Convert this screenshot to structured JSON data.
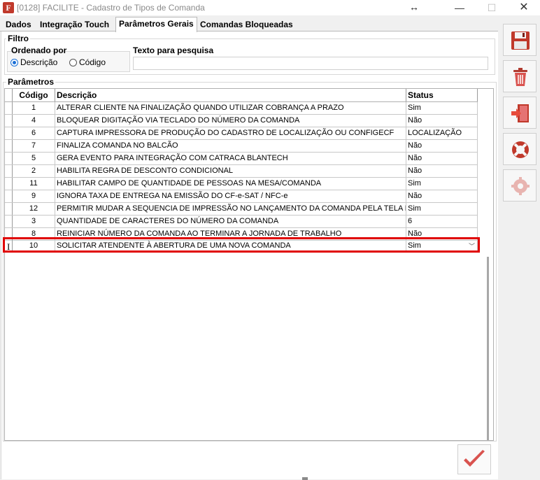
{
  "window": {
    "title": "[0128] FACILITE - Cadastro de Tipos de Comanda",
    "app_icon_letter": "F",
    "min_glyph": "—",
    "max_glyph": "☐",
    "close_glyph": "✕",
    "resize_glyph": "↔"
  },
  "tabs": [
    {
      "label": "Dados",
      "active": false
    },
    {
      "label": "Integração Touch",
      "active": false
    },
    {
      "label": "Parâmetros Gerais",
      "active": true
    },
    {
      "label": "Comandas Bloqueadas",
      "active": false
    }
  ],
  "filtro": {
    "group_label": "Filtro",
    "ordenado_label": "Ordenado por",
    "options": [
      {
        "label": "Descrição",
        "selected": true
      },
      {
        "label": "Código",
        "selected": false
      }
    ],
    "search_label": "Texto para pesquisa",
    "search_value": ""
  },
  "parametros": {
    "group_label": "Parâmetros",
    "columns": {
      "codigo": "Código",
      "descricao": "Descrição",
      "status": "Status"
    },
    "rows": [
      {
        "codigo": "1",
        "descricao": "ALTERAR CLIENTE NA FINALIZAÇÃO QUANDO UTILIZAR COBRANÇA A PRAZO",
        "status": "Sim"
      },
      {
        "codigo": "4",
        "descricao": "BLOQUEAR DIGITAÇÃO VIA TECLADO DO NÚMERO DA COMANDA",
        "status": "Não"
      },
      {
        "codigo": "6",
        "descricao": "CAPTURA IMPRESSORA DE PRODUÇÃO DO CADASTRO DE LOCALIZAÇÃO OU CONFIGECF",
        "status": "LOCALIZAÇÃO"
      },
      {
        "codigo": "7",
        "descricao": "FINALIZA COMANDA NO BALCÃO",
        "status": "Não"
      },
      {
        "codigo": "5",
        "descricao": "GERA EVENTO PARA INTEGRAÇÃO COM CATRACA BLANTECH",
        "status": "Não"
      },
      {
        "codigo": "2",
        "descricao": "HABILITA REGRA DE DESCONTO CONDICIONAL",
        "status": "Não"
      },
      {
        "codigo": "11",
        "descricao": "HABILITAR CAMPO DE QUANTIDADE DE PESSOAS NA MESA/COMANDA",
        "status": "Sim"
      },
      {
        "codigo": "9",
        "descricao": "IGNORA TAXA DE ENTREGA NA EMISSÃO DO CF-e-SAT / NFC-e",
        "status": "Não"
      },
      {
        "codigo": "12",
        "descricao": "PERMITIR MUDAR A SEQUENCIA DE IMPRESSÃO NO LANÇAMENTO DA COMANDA PELA TELA DE LANÇA",
        "status": "Sim"
      },
      {
        "codigo": "3",
        "descricao": "QUANTIDADE DE CARACTERES DO NÚMERO DA COMANDA",
        "status": "6"
      },
      {
        "codigo": "8",
        "descricao": "REINICIAR NÚMERO DA COMANDA AO TERMINAR A JORNADA DE TRABALHO",
        "status": "Não"
      },
      {
        "codigo": "10",
        "descricao": "SOLICITAR ATENDENTE À ABERTURA DE UMA NOVA COMANDA",
        "status": "Sim"
      }
    ],
    "selected_row_index": 11,
    "ibeam_glyph": "I",
    "dropdown_glyph": "﹀"
  },
  "sidebar": {
    "buttons": [
      {
        "name": "save-button",
        "icon": "floppy-disk-icon"
      },
      {
        "name": "delete-button",
        "icon": "trash-can-icon"
      },
      {
        "name": "exit-button",
        "icon": "exit-door-icon"
      },
      {
        "name": "help-button",
        "icon": "lifebuoy-icon"
      },
      {
        "name": "settings-button",
        "icon": "gear-icon",
        "disabled": true
      }
    ]
  },
  "confirm": {
    "icon": "checkmark-icon"
  },
  "colors": {
    "accent": "#1a6fd6",
    "highlight": "#e00000",
    "icon_red": "#c0392b"
  }
}
